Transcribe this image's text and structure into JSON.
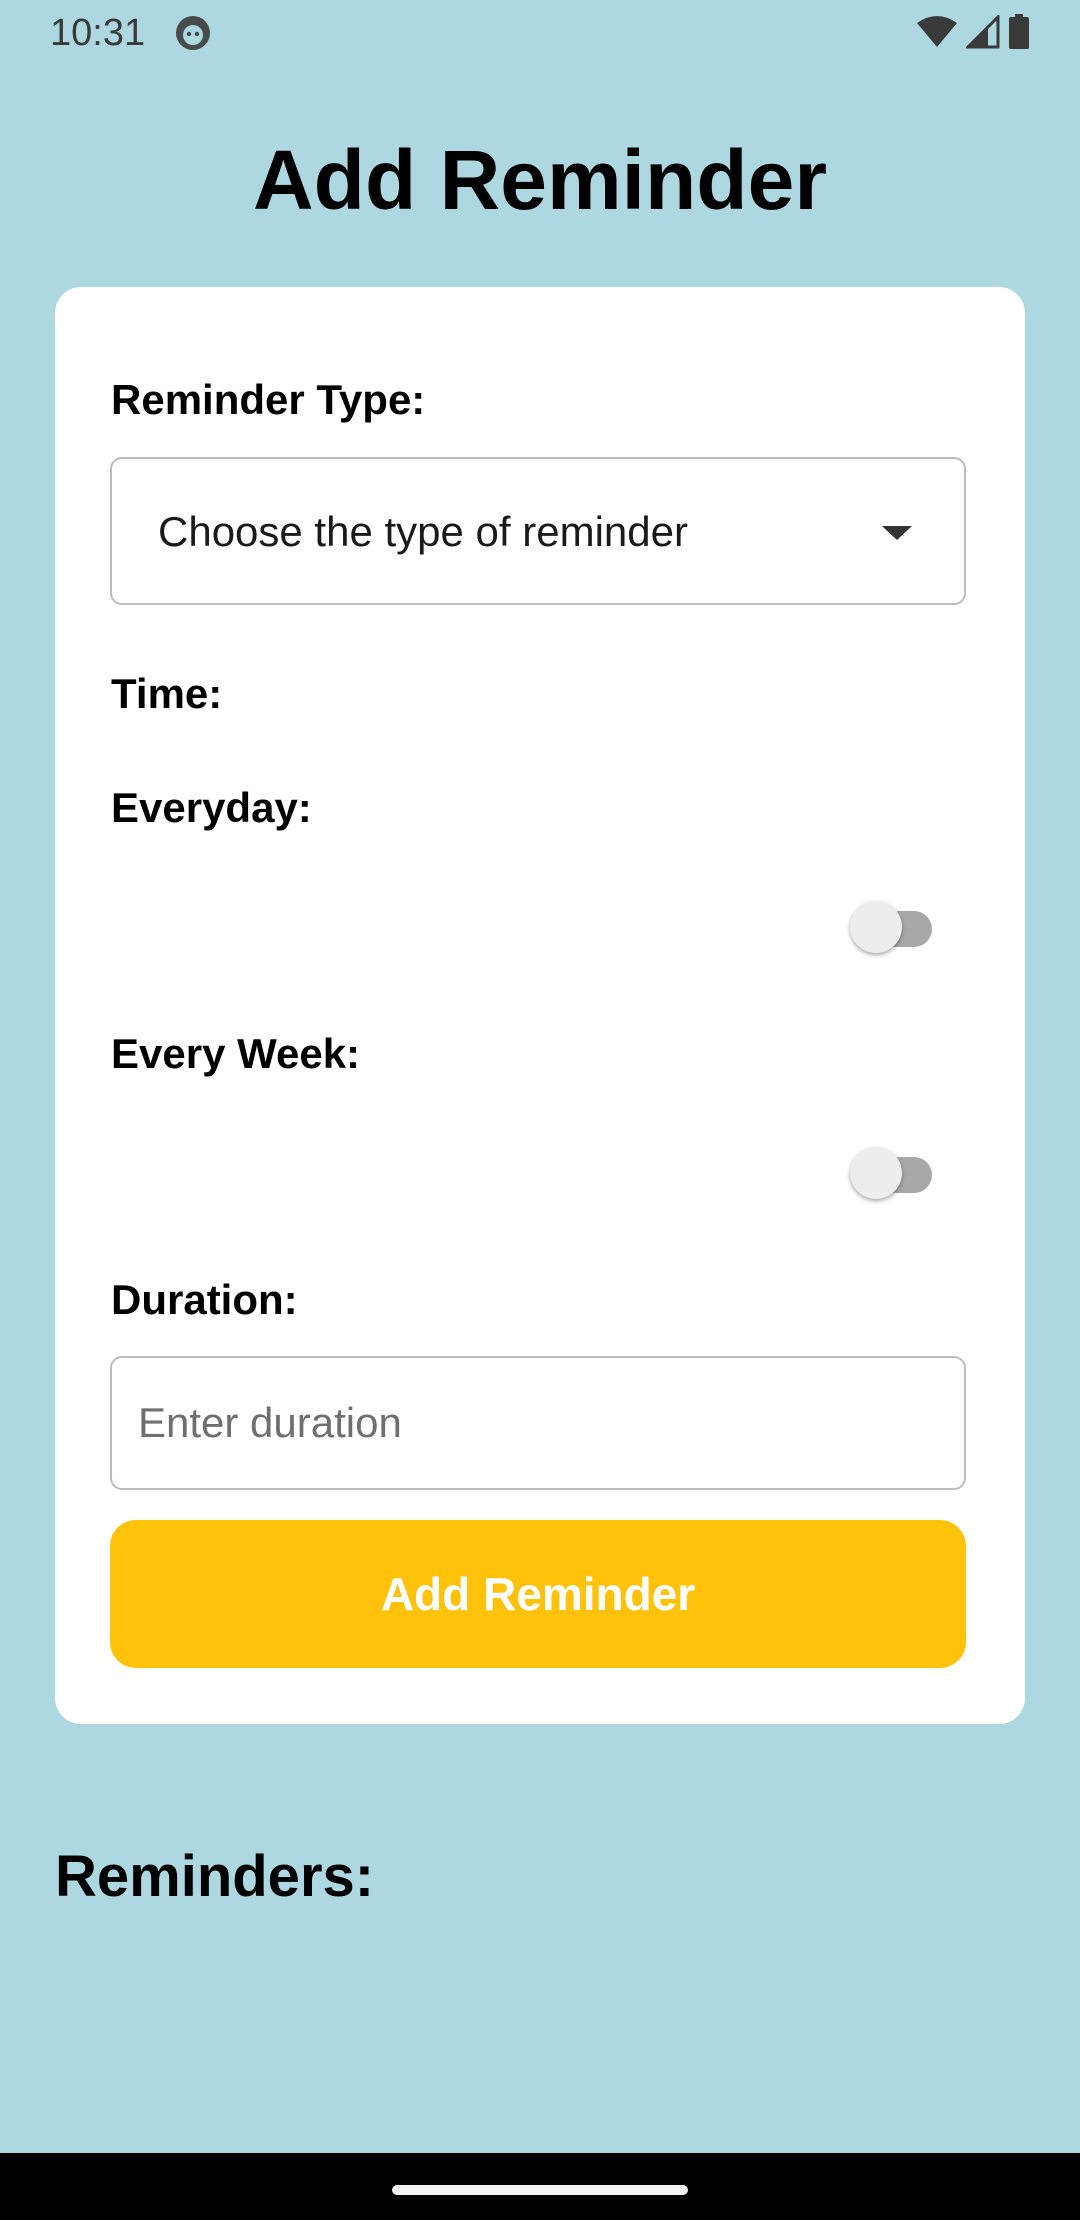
{
  "status_bar": {
    "time": "10:31",
    "app_icon": "android-face-icon",
    "icons": [
      "wifi-icon",
      "cell-signal-icon",
      "battery-icon"
    ]
  },
  "page": {
    "title": "Add Reminder"
  },
  "form": {
    "reminder_type_label": "Reminder Type:",
    "reminder_type_value": "Choose the type of reminder",
    "time_label": "Time:",
    "everyday_label": "Everyday:",
    "everyday_on": false,
    "every_week_label": "Every Week:",
    "every_week_on": false,
    "duration_label": "Duration:",
    "duration_placeholder": "Enter duration",
    "duration_value": "",
    "submit_label": "Add Reminder"
  },
  "reminders": {
    "title": "Reminders:",
    "items": []
  },
  "colors": {
    "background": "#ADD8E2",
    "card": "#FFFFFF",
    "button": "#FFC20A",
    "button_text": "#FFFFFF"
  }
}
